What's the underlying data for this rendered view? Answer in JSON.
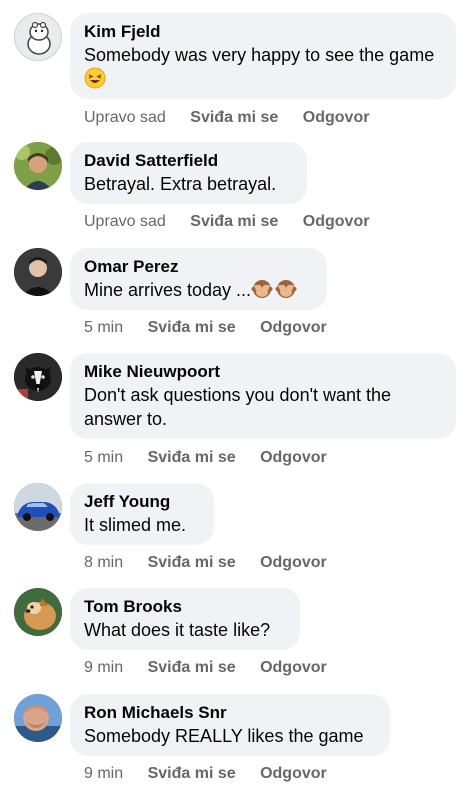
{
  "actions": {
    "like_label": "Sviđa mi se",
    "reply_label": "Odgovor"
  },
  "comments": [
    {
      "name": "Kim Fjeld",
      "text": "Somebody was very happy to see the game",
      "time": "Upravo sad"
    },
    {
      "name": "David Satterfield",
      "text": "Betrayal.  Extra betrayal.",
      "time": "Upravo sad"
    },
    {
      "name": "Omar Perez",
      "text": "Mine arrives today ...",
      "time": "5 min"
    },
    {
      "name": "Mike Nieuwpoort",
      "text": "Don't ask questions you don't want the answer to.",
      "time": "5 min"
    },
    {
      "name": "Jeff Young",
      "text": "It slimed me.",
      "time": "8 min"
    },
    {
      "name": "Tom Brooks",
      "text": "What does it taste like?",
      "time": "9 min"
    },
    {
      "name": "Ron Michaels Snr",
      "text": "Somebody REALLY likes the game",
      "time": "9 min"
    }
  ]
}
